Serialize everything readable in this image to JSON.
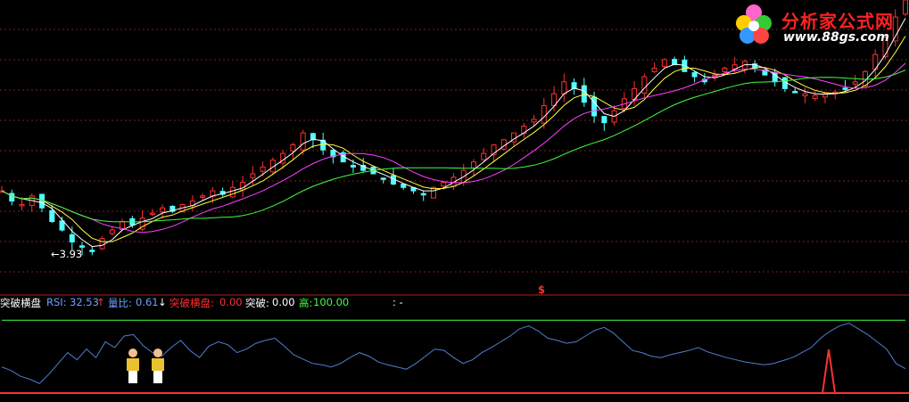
{
  "logo": {
    "title": "分析家公式网",
    "url": "www.88gs.com"
  },
  "indicator": {
    "name": "突破横盘",
    "rsi_label": "RSI:",
    "rsi_value": "32.53",
    "rsi_arrow": "↑",
    "volratio_label": "量比:",
    "volratio_value": "0.61",
    "volratio_arrow": "↓",
    "breakout_flat_label": "突破横盘:",
    "breakout_flat_value": "0.00",
    "breakout_label": "突破:",
    "breakout_value": "0.00",
    "high_label": "高:",
    "high_value": "100.00",
    "trailing": ": -"
  },
  "price_marker": {
    "label": "←3.93"
  },
  "signal_marker": {
    "label": "$"
  },
  "colors": {
    "up_candle": "#ff3030",
    "down_candle": "#54ffff",
    "ma_white": "#ffffff",
    "ma_yellow": "#ffff40",
    "ma_magenta": "#ff40ff",
    "ma_green": "#40ff40",
    "rsi_line": "#4f7fd0",
    "high_line": "#40ff40",
    "baseline": "#ff3030",
    "grid": "#7a2020"
  },
  "chart_data": [
    {
      "type": "candlestick",
      "title": "",
      "note": "values in price units (low marked at 3.93)",
      "ylim": [
        3.7,
        5.4
      ],
      "closes": [
        4.28,
        4.22,
        4.2,
        4.25,
        4.18,
        4.1,
        4.05,
        3.98,
        3.95,
        3.93,
        4.0,
        4.05,
        4.1,
        4.08,
        4.12,
        4.15,
        4.18,
        4.16,
        4.2,
        4.22,
        4.25,
        4.28,
        4.26,
        4.3,
        4.33,
        4.38,
        4.42,
        4.46,
        4.5,
        4.55,
        4.62,
        4.58,
        4.52,
        4.48,
        4.45,
        4.42,
        4.4,
        4.38,
        4.35,
        4.32,
        4.3,
        4.28,
        4.26,
        4.3,
        4.33,
        4.36,
        4.4,
        4.45,
        4.5,
        4.55,
        4.58,
        4.62,
        4.66,
        4.7,
        4.78,
        4.85,
        4.92,
        4.88,
        4.8,
        4.72,
        4.68,
        4.75,
        4.82,
        4.88,
        4.95,
        5.0,
        5.05,
        5.02,
        4.98,
        4.95,
        4.92,
        4.96,
        5.0,
        5.02,
        5.04,
        5.0,
        4.96,
        4.92,
        4.88,
        4.86,
        4.85,
        4.84,
        4.85,
        4.86,
        4.88,
        4.92,
        4.98,
        5.08,
        5.18,
        5.3,
        5.4
      ],
      "series": [
        {
          "name": "",
          "color": "#ffffff"
        },
        {
          "name": "",
          "color": "#ffff40"
        },
        {
          "name": "",
          "color": "#ff40ff"
        },
        {
          "name": "",
          "color": "#40ff40"
        }
      ]
    },
    {
      "type": "line",
      "title": "",
      "ylim": [
        0,
        100
      ],
      "series": [
        {
          "name": "RSI",
          "values": [
            35,
            30,
            22,
            18,
            12,
            25,
            40,
            55,
            45,
            60,
            48,
            70,
            62,
            78,
            80,
            65,
            55,
            50,
            62,
            72,
            58,
            48,
            64,
            70,
            66,
            55,
            60,
            68,
            72,
            75,
            64,
            52,
            46,
            40,
            38,
            35,
            40,
            48,
            55,
            50,
            42,
            38,
            35,
            32,
            40,
            50,
            60,
            58,
            48,
            40,
            45,
            55,
            62,
            70,
            78,
            88,
            92,
            85,
            75,
            72,
            68,
            70,
            78,
            86,
            90,
            82,
            70,
            58,
            55,
            50,
            48,
            52,
            55,
            58,
            62,
            56,
            52,
            48,
            45,
            42,
            40,
            38,
            40,
            44,
            48,
            55,
            62,
            75,
            85,
            92,
            96,
            88,
            80,
            70,
            60,
            40,
            32.53
          ]
        },
        {
          "name": "",
          "values": [
            100,
            100,
            100,
            100,
            100,
            100,
            100,
            100,
            100,
            100,
            100,
            100,
            100,
            100,
            100,
            100,
            100,
            100,
            100,
            100,
            100,
            100,
            100,
            100,
            100,
            100,
            100,
            100,
            100,
            100,
            100,
            100,
            100,
            100,
            100,
            100,
            100,
            100,
            100,
            100,
            100,
            100,
            100,
            100,
            100,
            100,
            100,
            100,
            100,
            100,
            100,
            100,
            100,
            100,
            100,
            100,
            100,
            100,
            100,
            100,
            100,
            100,
            100,
            100,
            100,
            100,
            100,
            100,
            100,
            100,
            100,
            100,
            100,
            100,
            100,
            100,
            100,
            100,
            100,
            100,
            100,
            100,
            100,
            100,
            100,
            100,
            100,
            100,
            100,
            100,
            100,
            100,
            100,
            100,
            100,
            100,
            100
          ]
        }
      ]
    }
  ]
}
